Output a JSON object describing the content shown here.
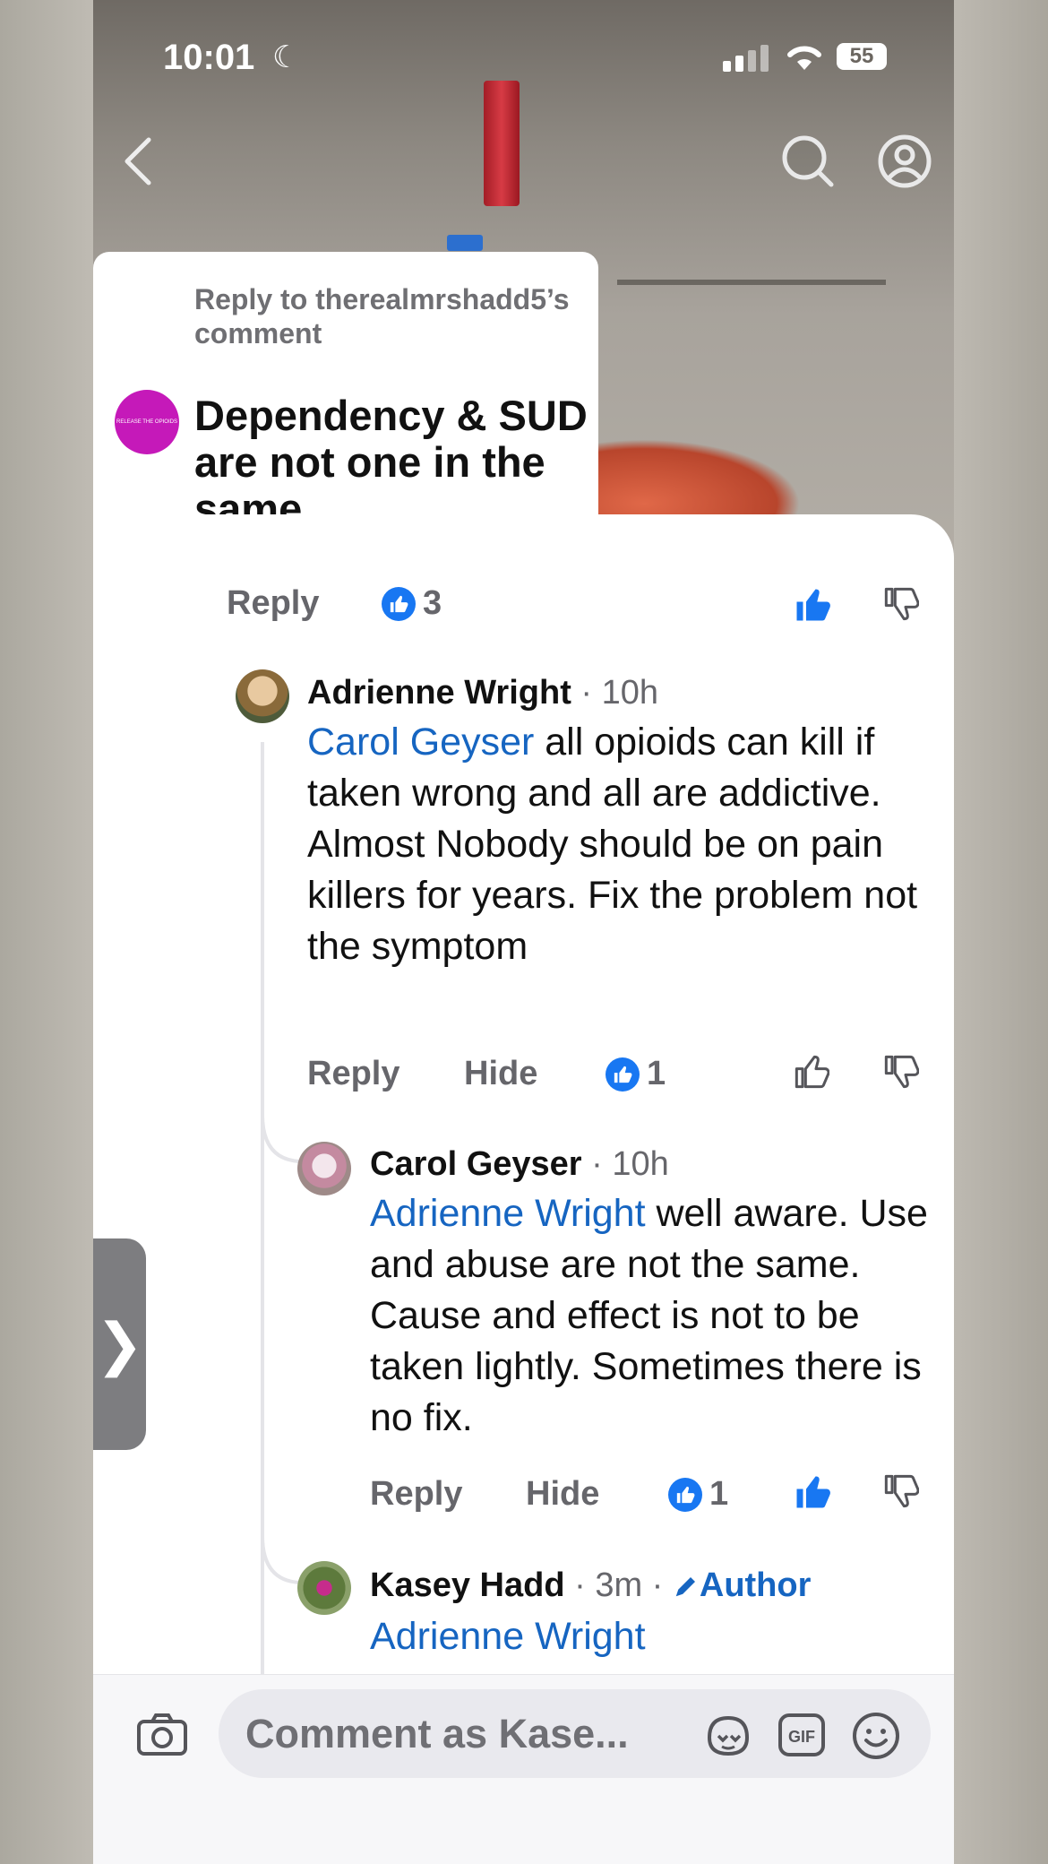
{
  "status_bar": {
    "time": "10:01",
    "battery": "55"
  },
  "op": {
    "reply_to": "Reply to therealmrshadd5’s comment",
    "avatar_text": "RELEASE THE OPIOIDS",
    "text": "Dependency & SUD are not one in the same."
  },
  "op_actions": {
    "reply": "Reply",
    "likes": "3"
  },
  "comments": [
    {
      "name": "Adrienne Wright",
      "meta": " · 10h",
      "mention": "Carol Geyser",
      "text": " all opioids can kill if taken wrong and all are addictive. Almost Nobody should be on pain killers for years. Fix the problem not the symptom",
      "reply": "Reply",
      "hide": "Hide",
      "likes": "1"
    },
    {
      "name": "Carol Geyser",
      "meta": " · 10h",
      "mention": "Adrienne Wright",
      "text": " well aware. Use and abuse are not the same. Cause and effect is not to be taken lightly. Sometimes there is no fix.",
      "reply": "Reply",
      "hide": "Hide",
      "likes": "1"
    },
    {
      "name": "Kasey Hadd",
      "meta": " · 3m · ",
      "author": "Author",
      "mention": "Adrienne Wright"
    }
  ],
  "composer": {
    "placeholder": "Comment as Kase..."
  },
  "colors": {
    "accent": "#1877f2",
    "mention": "#1665c1",
    "op_avatar": "#c519b9"
  }
}
